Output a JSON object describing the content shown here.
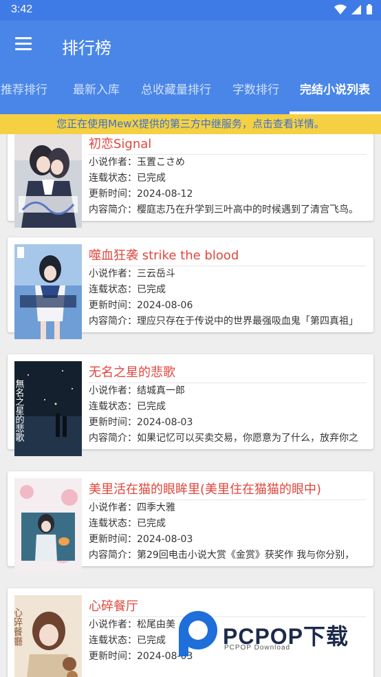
{
  "status_bar": {
    "time": "3:42"
  },
  "app_bar": {
    "title": "排行榜"
  },
  "tabs": [
    {
      "label": "日推荐排行"
    },
    {
      "label": "最新入库"
    },
    {
      "label": "总收藏量排行"
    },
    {
      "label": "字数排行"
    },
    {
      "label": "完结小说列表",
      "active": true
    }
  ],
  "notice": "您正在使用MewX提供的第三方中继服务，点击查看详情。",
  "labels": {
    "author": "小说作者：",
    "status": "连载状态：",
    "updated": "更新时间：",
    "intro": "内容简介："
  },
  "books": [
    {
      "title": "初恋Signal",
      "author": "玉置こさめ",
      "status": "已完成",
      "updated": "2024-08-12",
      "intro": "樱庭志乃在升学到三叶高中的时候遇到了清宫飞鸟。"
    },
    {
      "title": "噬血狂袭 strike the blood",
      "author": "三云岳斗",
      "status": "已完成",
      "updated": "2024-08-06",
      "intro": "理应只存在于传说中的世界最强吸血鬼「第四真祖」"
    },
    {
      "title": "无名之星的悲歌",
      "author": "结城真一郎",
      "status": "已完成",
      "updated": "2024-08-03",
      "intro": "如果记忆可以买卖交易，你愿意为了什么，放弃你之"
    },
    {
      "title": "美里活在猫的眼眸里(美里住在猫猫的眼中)",
      "author": "四季大雅",
      "status": "已完成",
      "updated": "2024-08-03",
      "intro": "第29回电击小说大赏《金赏》获奖作 我与你分别，"
    },
    {
      "title": "心碎餐厅",
      "author": "松尾由美",
      "status": "已完成",
      "updated": "2024-08-03",
      "intro": ""
    }
  ],
  "cover_texts": [
    "無名之星的悲歌",
    "心碎餐廳"
  ],
  "watermark": {
    "main": "PCPOP下载",
    "sub": "PCPOP Download"
  },
  "colors": {
    "primary": "#4a86e8",
    "title_red": "#e0463c",
    "notice_bg": "#f5d042",
    "notice_text": "#3a6fcf"
  }
}
